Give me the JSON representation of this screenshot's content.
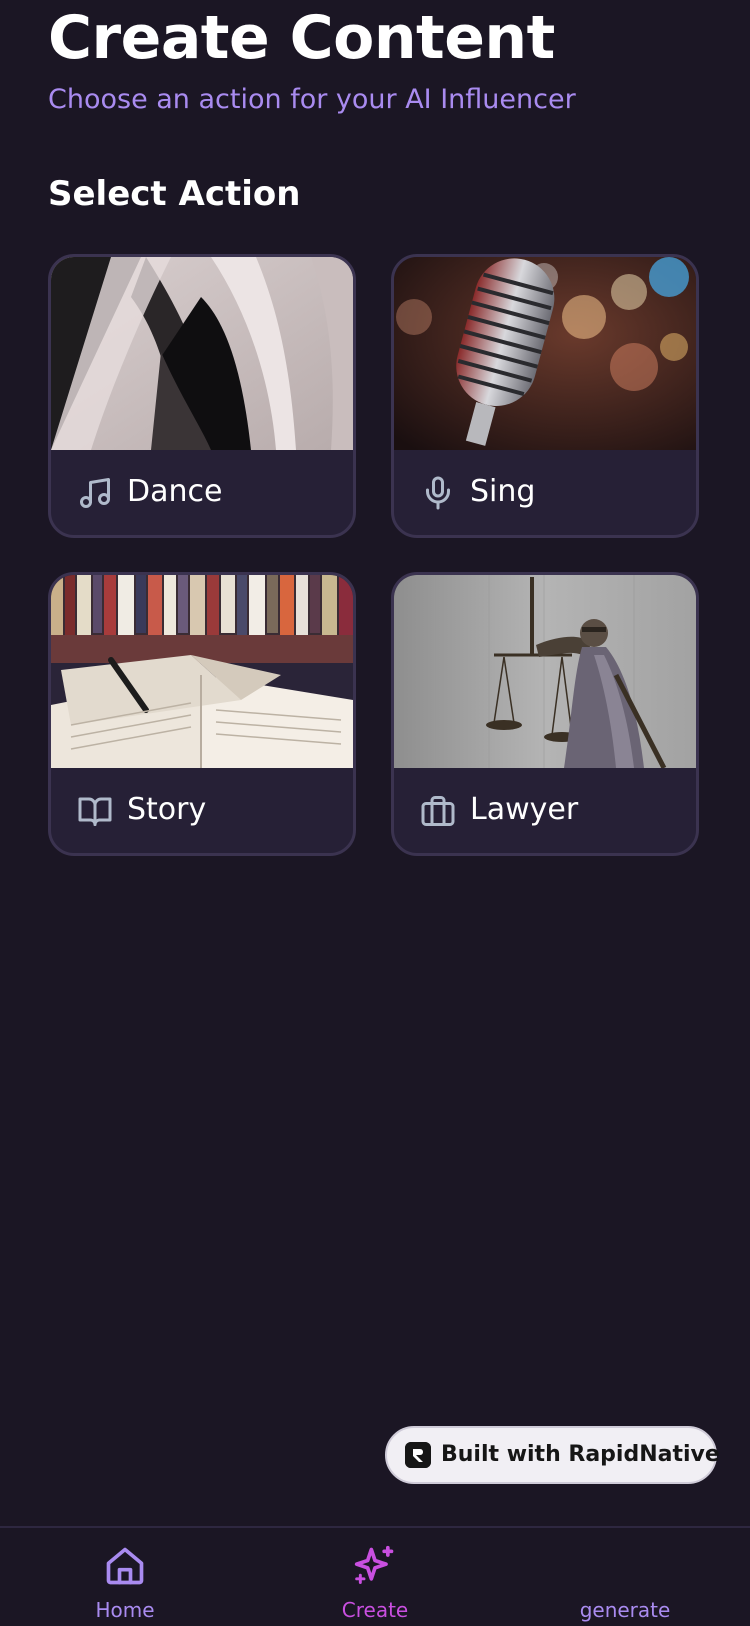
{
  "header": {
    "title": "Create Content",
    "subtitle": "Choose an action for your AI Influencer"
  },
  "section": {
    "title": "Select Action"
  },
  "actions": [
    {
      "label": "Dance",
      "icon": "music-note-icon",
      "image": "abstract-sculpture-image"
    },
    {
      "label": "Sing",
      "icon": "microphone-icon",
      "image": "microphone-image"
    },
    {
      "label": "Story",
      "icon": "book-open-icon",
      "image": "open-book-image"
    },
    {
      "label": "Lawyer",
      "icon": "briefcase-icon",
      "image": "lady-justice-image"
    }
  ],
  "badge": {
    "text": "Built with RapidNative",
    "icon": "rapidnative-logo-icon"
  },
  "nav": {
    "items": [
      {
        "label": "Home",
        "icon": "home-icon",
        "active": false
      },
      {
        "label": "Create",
        "icon": "sparkles-icon",
        "active": true
      },
      {
        "label": "generate",
        "icon": "",
        "active": false
      }
    ]
  },
  "colors": {
    "background": "#1b1624",
    "card": "#262036",
    "card_border": "#3b3350",
    "accent": "#a98bf0",
    "active_nav": "#c94fe0",
    "text": "#ffffff",
    "icon": "#b0bacb"
  }
}
